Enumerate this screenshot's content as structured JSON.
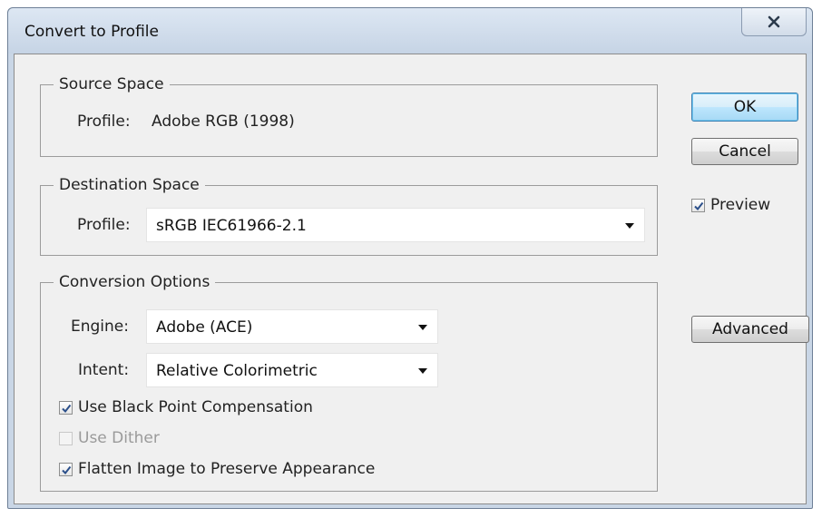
{
  "window": {
    "title": "Convert to Profile",
    "close_icon": "close-icon"
  },
  "source_space": {
    "legend": "Source Space",
    "profile_label": "Profile:",
    "profile_value": "Adobe RGB (1998)"
  },
  "destination_space": {
    "legend": "Destination Space",
    "profile_label": "Profile:",
    "profile_value": "sRGB IEC61966-2.1"
  },
  "conversion_options": {
    "legend": "Conversion Options",
    "engine_label": "Engine:",
    "engine_value": "Adobe (ACE)",
    "intent_label": "Intent:",
    "intent_value": "Relative Colorimetric",
    "black_point": {
      "label": "Use Black Point Compensation",
      "checked": true,
      "enabled": true
    },
    "dither": {
      "label": "Use Dither",
      "checked": false,
      "enabled": false
    },
    "flatten": {
      "label": "Flatten Image to Preserve Appearance",
      "checked": true,
      "enabled": true
    }
  },
  "buttons": {
    "ok": "OK",
    "cancel": "Cancel",
    "advanced": "Advanced"
  },
  "preview": {
    "label": "Preview",
    "checked": true
  },
  "colors": {
    "default_button_border": "#3c7fb1",
    "dialog_background": "#f0f0f0",
    "title_bar": "#c9d6e6"
  }
}
